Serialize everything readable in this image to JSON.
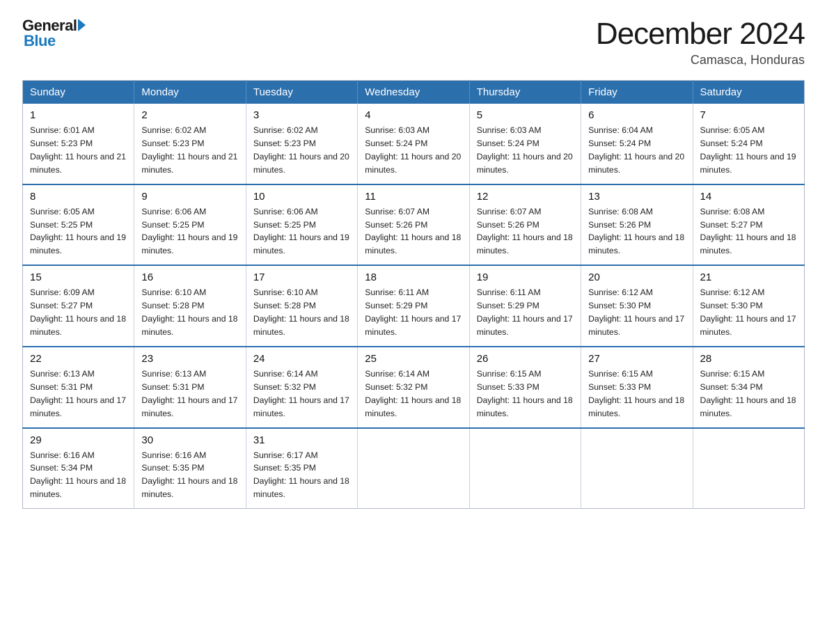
{
  "header": {
    "logo": {
      "general": "General",
      "arrow": "▶",
      "blue": "Blue"
    },
    "title": "December 2024",
    "subtitle": "Camasca, Honduras"
  },
  "calendar": {
    "days_of_week": [
      "Sunday",
      "Monday",
      "Tuesday",
      "Wednesday",
      "Thursday",
      "Friday",
      "Saturday"
    ],
    "weeks": [
      [
        {
          "day": "1",
          "sunrise": "6:01 AM",
          "sunset": "5:23 PM",
          "daylight": "11 hours and 21 minutes."
        },
        {
          "day": "2",
          "sunrise": "6:02 AM",
          "sunset": "5:23 PM",
          "daylight": "11 hours and 21 minutes."
        },
        {
          "day": "3",
          "sunrise": "6:02 AM",
          "sunset": "5:23 PM",
          "daylight": "11 hours and 20 minutes."
        },
        {
          "day": "4",
          "sunrise": "6:03 AM",
          "sunset": "5:24 PM",
          "daylight": "11 hours and 20 minutes."
        },
        {
          "day": "5",
          "sunrise": "6:03 AM",
          "sunset": "5:24 PM",
          "daylight": "11 hours and 20 minutes."
        },
        {
          "day": "6",
          "sunrise": "6:04 AM",
          "sunset": "5:24 PM",
          "daylight": "11 hours and 20 minutes."
        },
        {
          "day": "7",
          "sunrise": "6:05 AM",
          "sunset": "5:24 PM",
          "daylight": "11 hours and 19 minutes."
        }
      ],
      [
        {
          "day": "8",
          "sunrise": "6:05 AM",
          "sunset": "5:25 PM",
          "daylight": "11 hours and 19 minutes."
        },
        {
          "day": "9",
          "sunrise": "6:06 AM",
          "sunset": "5:25 PM",
          "daylight": "11 hours and 19 minutes."
        },
        {
          "day": "10",
          "sunrise": "6:06 AM",
          "sunset": "5:25 PM",
          "daylight": "11 hours and 19 minutes."
        },
        {
          "day": "11",
          "sunrise": "6:07 AM",
          "sunset": "5:26 PM",
          "daylight": "11 hours and 18 minutes."
        },
        {
          "day": "12",
          "sunrise": "6:07 AM",
          "sunset": "5:26 PM",
          "daylight": "11 hours and 18 minutes."
        },
        {
          "day": "13",
          "sunrise": "6:08 AM",
          "sunset": "5:26 PM",
          "daylight": "11 hours and 18 minutes."
        },
        {
          "day": "14",
          "sunrise": "6:08 AM",
          "sunset": "5:27 PM",
          "daylight": "11 hours and 18 minutes."
        }
      ],
      [
        {
          "day": "15",
          "sunrise": "6:09 AM",
          "sunset": "5:27 PM",
          "daylight": "11 hours and 18 minutes."
        },
        {
          "day": "16",
          "sunrise": "6:10 AM",
          "sunset": "5:28 PM",
          "daylight": "11 hours and 18 minutes."
        },
        {
          "day": "17",
          "sunrise": "6:10 AM",
          "sunset": "5:28 PM",
          "daylight": "11 hours and 18 minutes."
        },
        {
          "day": "18",
          "sunrise": "6:11 AM",
          "sunset": "5:29 PM",
          "daylight": "11 hours and 17 minutes."
        },
        {
          "day": "19",
          "sunrise": "6:11 AM",
          "sunset": "5:29 PM",
          "daylight": "11 hours and 17 minutes."
        },
        {
          "day": "20",
          "sunrise": "6:12 AM",
          "sunset": "5:30 PM",
          "daylight": "11 hours and 17 minutes."
        },
        {
          "day": "21",
          "sunrise": "6:12 AM",
          "sunset": "5:30 PM",
          "daylight": "11 hours and 17 minutes."
        }
      ],
      [
        {
          "day": "22",
          "sunrise": "6:13 AM",
          "sunset": "5:31 PM",
          "daylight": "11 hours and 17 minutes."
        },
        {
          "day": "23",
          "sunrise": "6:13 AM",
          "sunset": "5:31 PM",
          "daylight": "11 hours and 17 minutes."
        },
        {
          "day": "24",
          "sunrise": "6:14 AM",
          "sunset": "5:32 PM",
          "daylight": "11 hours and 17 minutes."
        },
        {
          "day": "25",
          "sunrise": "6:14 AM",
          "sunset": "5:32 PM",
          "daylight": "11 hours and 18 minutes."
        },
        {
          "day": "26",
          "sunrise": "6:15 AM",
          "sunset": "5:33 PM",
          "daylight": "11 hours and 18 minutes."
        },
        {
          "day": "27",
          "sunrise": "6:15 AM",
          "sunset": "5:33 PM",
          "daylight": "11 hours and 18 minutes."
        },
        {
          "day": "28",
          "sunrise": "6:15 AM",
          "sunset": "5:34 PM",
          "daylight": "11 hours and 18 minutes."
        }
      ],
      [
        {
          "day": "29",
          "sunrise": "6:16 AM",
          "sunset": "5:34 PM",
          "daylight": "11 hours and 18 minutes."
        },
        {
          "day": "30",
          "sunrise": "6:16 AM",
          "sunset": "5:35 PM",
          "daylight": "11 hours and 18 minutes."
        },
        {
          "day": "31",
          "sunrise": "6:17 AM",
          "sunset": "5:35 PM",
          "daylight": "11 hours and 18 minutes."
        },
        null,
        null,
        null,
        null
      ]
    ]
  }
}
